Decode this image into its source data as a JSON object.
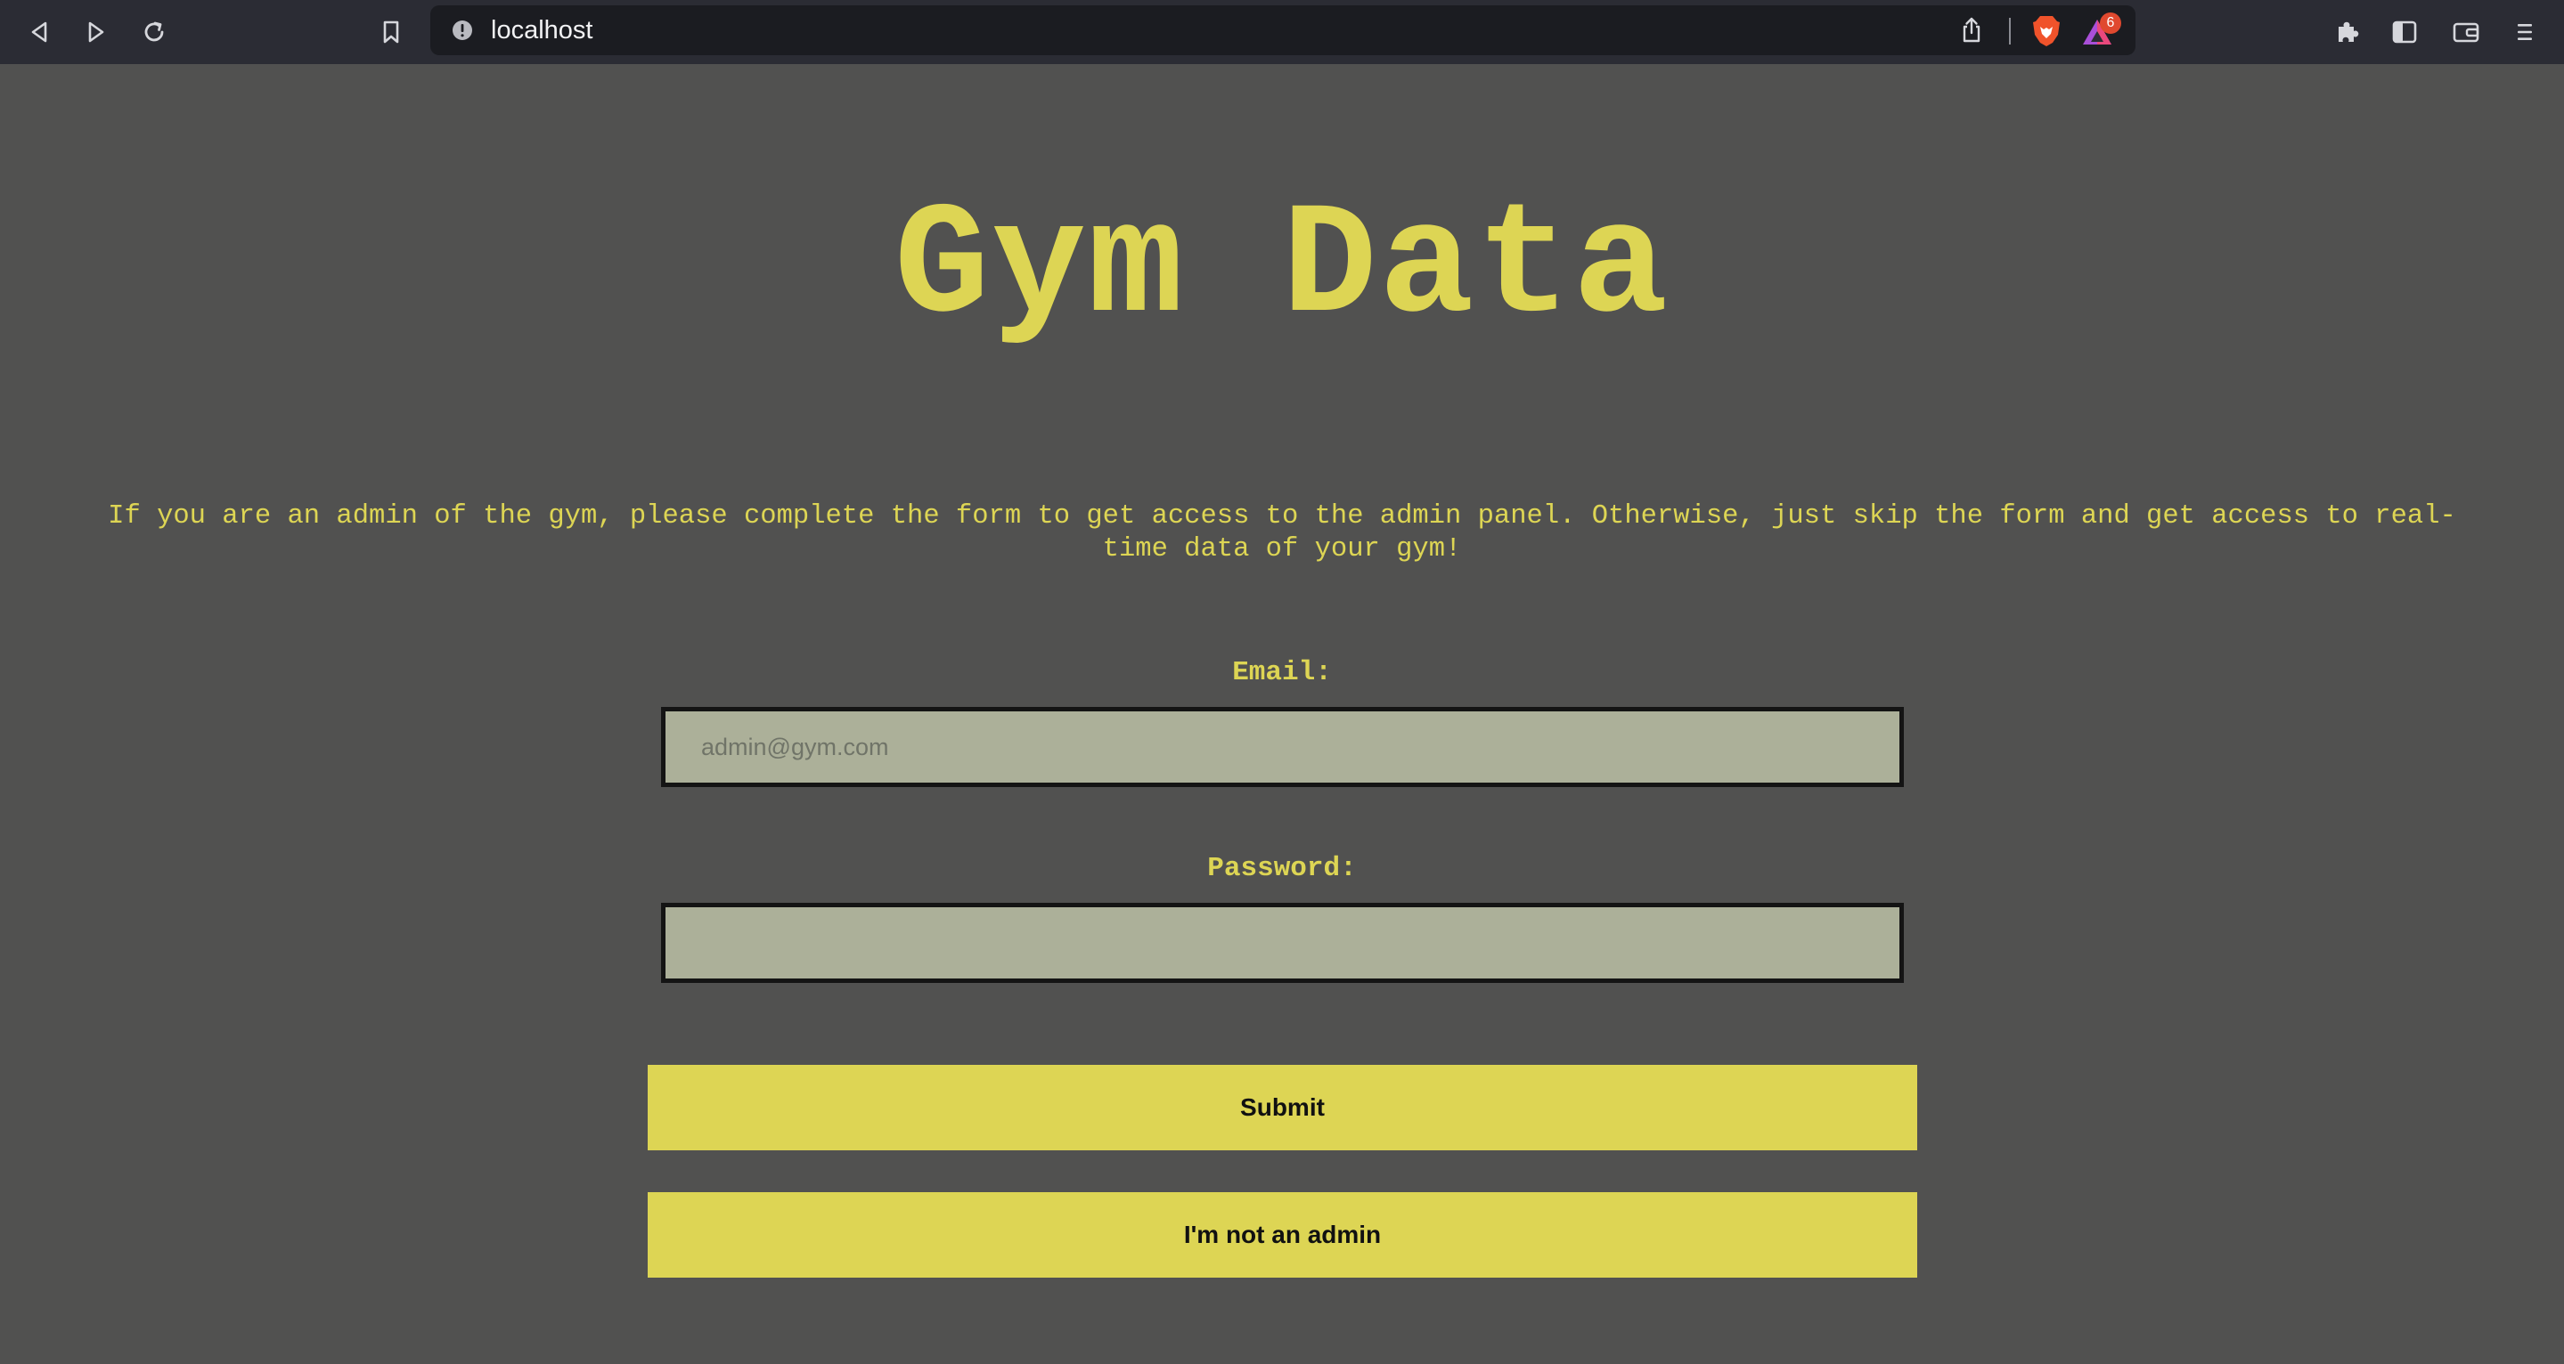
{
  "browser": {
    "url": "localhost",
    "rewards_badge_count": "6",
    "icons": {
      "back": "back-arrow-icon",
      "forward": "forward-arrow-icon",
      "reload": "reload-icon",
      "bookmark": "bookmark-icon",
      "site_info": "info-icon",
      "share": "share-icon",
      "brave_shields": "brave-lion-icon",
      "rewards": "brave-rewards-icon",
      "extensions": "puzzle-icon",
      "sidebar": "sidebar-icon",
      "wallet": "wallet-icon",
      "menu": "hamburger-menu-icon"
    }
  },
  "page": {
    "title": "Gym Data",
    "intro": "If you are an admin of the gym, please complete the form to get access to the admin panel. Otherwise, just skip the form and get access to real-time data of your gym!",
    "form": {
      "email_label": "Email:",
      "email_placeholder": "admin@gym.com",
      "email_value": "",
      "password_label": "Password:",
      "password_value": "",
      "submit_label": "Submit",
      "not_admin_label": "I'm not an admin"
    }
  },
  "colors": {
    "page_background": "#515150",
    "accent_yellow": "#ddd554",
    "input_background": "#acb099",
    "chrome_background": "#2b2c34",
    "urlbar_background": "#1b1c21",
    "badge_red": "#e0492f"
  }
}
